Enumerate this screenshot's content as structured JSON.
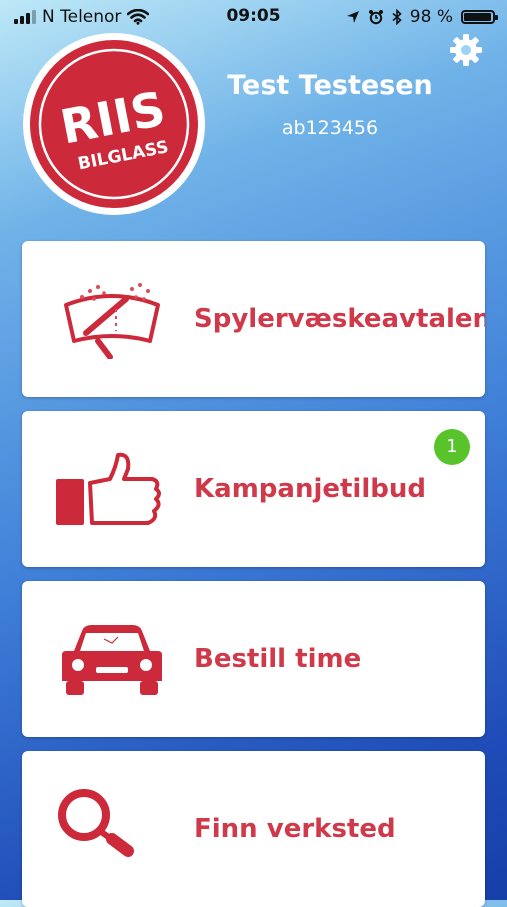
{
  "status_bar": {
    "carrier": "N Telenor",
    "time": "09:05",
    "battery_text": "98 %",
    "battery_level": 0.98
  },
  "logo": {
    "line1": "RIIS",
    "line2": "BILGLASS"
  },
  "user": {
    "name": "Test Testesen",
    "id": "ab123456"
  },
  "menu": [
    {
      "label": "Spylervæskeavtalen",
      "icon": "windshield-washer-icon"
    },
    {
      "label": "Kampanjetilbud",
      "icon": "thumbs-up-icon",
      "badge": "1"
    },
    {
      "label": "Bestill time",
      "icon": "car-icon"
    },
    {
      "label": "Finn verksted",
      "icon": "magnifier-icon"
    }
  ],
  "colors": {
    "accent": "#d0394a",
    "badge": "#58c32a",
    "logo_red": "#cc2a3a"
  }
}
